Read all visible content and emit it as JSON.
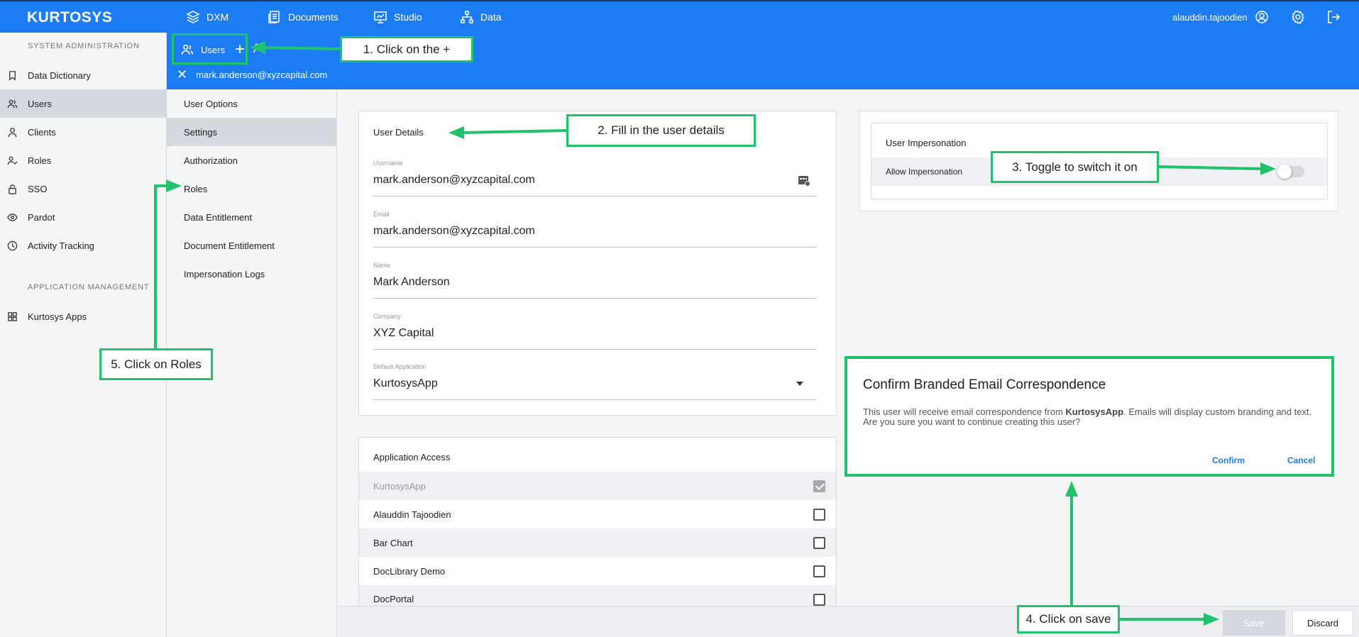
{
  "app": {
    "logo": "KURTOSYS",
    "nav": [
      {
        "label": "DXM",
        "icon": "layers-icon"
      },
      {
        "label": "Documents",
        "icon": "documents-icon"
      },
      {
        "label": "Studio",
        "icon": "presentation-icon"
      },
      {
        "label": "Data",
        "icon": "hierarchy-icon"
      }
    ],
    "user": "alauddin.tajoodien",
    "accent": "#1c7cf4"
  },
  "sidebar": {
    "system_title": "SYSTEM ADMINISTRATION",
    "items": [
      {
        "label": "Data Dictionary",
        "icon": "bookmark-icon"
      },
      {
        "label": "Users",
        "icon": "users-icon",
        "active": true
      },
      {
        "label": "Clients",
        "icon": "person-icon"
      },
      {
        "label": "Roles",
        "icon": "person-check-icon"
      },
      {
        "label": "SSO",
        "icon": "lock-icon"
      },
      {
        "label": "Pardot",
        "icon": "eye-icon"
      },
      {
        "label": "Activity Tracking",
        "icon": "clock-icon"
      }
    ],
    "app_title": "APPLICATION MANAGEMENT",
    "app_items": [
      {
        "label": "Kurtosys Apps",
        "icon": "grid-icon"
      }
    ]
  },
  "subheader": {
    "tab_label": "Users",
    "record_label": "mark.anderson@xyzcapital.com"
  },
  "subnav": {
    "items": [
      {
        "label": "User Options"
      },
      {
        "label": "Settings",
        "active": true
      },
      {
        "label": "Authorization"
      },
      {
        "label": "Roles"
      },
      {
        "label": "Data Entitlement"
      },
      {
        "label": "Document Entitlement"
      },
      {
        "label": "Impersonation Logs"
      }
    ]
  },
  "user_details": {
    "title": "User Details",
    "fields": [
      {
        "label": "Username",
        "value": "mark.anderson@xyzcapital.com"
      },
      {
        "label": "Email",
        "value": "mark.anderson@xyzcapital.com"
      },
      {
        "label": "Name",
        "value": "Mark Anderson"
      },
      {
        "label": "Company",
        "value": "XYZ Capital"
      },
      {
        "label": "Default Application",
        "value": "KurtosysApp"
      }
    ]
  },
  "app_access": {
    "title": "Application Access",
    "rows": [
      {
        "label": "KurtosysApp",
        "checked": true,
        "disabled": true
      },
      {
        "label": "Alauddin Tajoodien",
        "checked": false
      },
      {
        "label": "Bar Chart",
        "checked": false
      },
      {
        "label": "DocLibrary Demo",
        "checked": false
      },
      {
        "label": "DocPortal",
        "checked": false
      }
    ]
  },
  "impersonation": {
    "title": "User Impersonation",
    "row_label": "Allow Impersonation",
    "enabled": false
  },
  "dialog": {
    "title": "Confirm Branded Email Correspondence",
    "body_prefix": "This user will receive email correspondence from ",
    "body_bold": "KurtosysApp",
    "body_suffix": ". Emails will display custom branding and text. Are you sure you want to continue creating this user?",
    "confirm": "Confirm",
    "cancel": "Cancel"
  },
  "footer": {
    "save": "Save",
    "discard": "Discard"
  },
  "annotations": {
    "step1": "1. Click on the +",
    "step2": "2. Fill in the user details",
    "step3": "3. Toggle to switch it on",
    "step4": "4. Click on save",
    "step5": "5. Click on Roles",
    "color": "#21c26b"
  }
}
